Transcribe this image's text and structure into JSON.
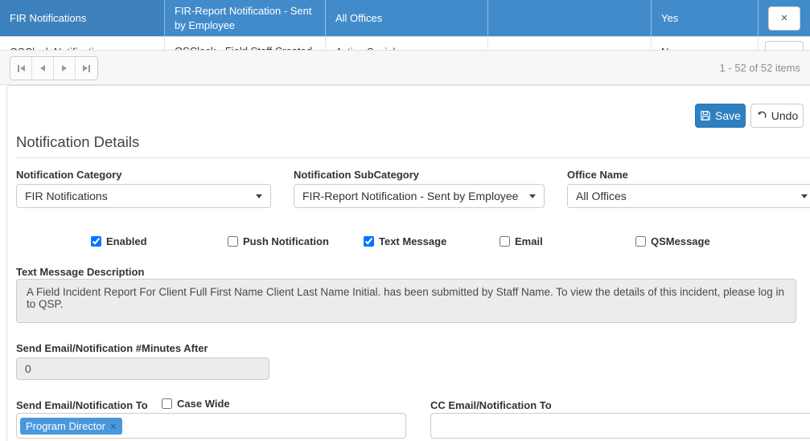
{
  "grid": {
    "rows": [
      {
        "category": "FIR Notifications",
        "subcategory": "FIR-Report Notification - Sent by Employee",
        "office": "All Offices",
        "col4": "",
        "enabled": "Yes"
      },
      {
        "category": "QSClock Notifications",
        "subcategory": "QSClock - Field Staff Created",
        "office": "Active Social",
        "col4": "",
        "enabled": "No"
      }
    ]
  },
  "icons": {
    "close_glyph": "×",
    "first_page": "first-page-icon",
    "prev_page": "previous-page-icon",
    "next_page": "next-page-icon",
    "last_page": "last-page-icon",
    "save": "floppy-disk-icon",
    "undo": "undo-arrow-icon"
  },
  "pager": {
    "info": "1 - 52 of 52 items"
  },
  "toolbar": {
    "save_label": "Save",
    "undo_label": "Undo"
  },
  "form": {
    "title": "Notification Details",
    "fields": {
      "category": {
        "label": "Notification Category",
        "value": "FIR Notifications"
      },
      "subcategory": {
        "label": "Notification SubCategory",
        "value": "FIR-Report Notification - Sent by Employee"
      },
      "office": {
        "label": "Office Name",
        "value": "All Offices"
      }
    },
    "checkboxes": [
      {
        "label": "Enabled",
        "checked": true
      },
      {
        "label": "Push Notification",
        "checked": false
      },
      {
        "label": "Text Message",
        "checked": true
      },
      {
        "label": "Email",
        "checked": false
      },
      {
        "label": "QSMessage",
        "checked": false
      }
    ],
    "text_message": {
      "label": "Text Message Description",
      "value": "A Field Incident Report For Client Full First Name Client Last Name Initial. has been submitted by Staff Name. To view the details of this incident, please log in to QSP."
    },
    "minutes": {
      "label": "Send Email/Notification #Minutes After",
      "value": "0"
    },
    "send_to": {
      "label": "Send Email/Notification To",
      "case_wide_label": "Case Wide",
      "case_wide_checked": false,
      "tags": [
        "Program Director"
      ]
    },
    "cc_to": {
      "label": "CC Email/Notification To",
      "value": ""
    }
  }
}
